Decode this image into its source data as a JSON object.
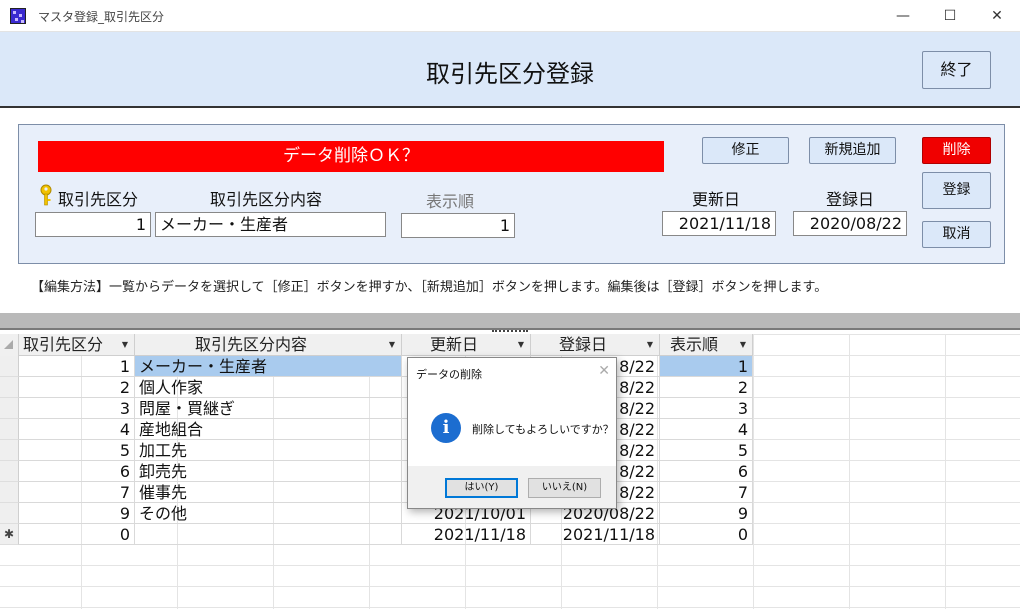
{
  "window": {
    "title": "マスタ登録_取引先区分",
    "minimize": "—",
    "maximize": "☐",
    "close": "✕"
  },
  "header": {
    "title": "取引先区分登録",
    "exit_label": "終了"
  },
  "edit": {
    "banner": "データ削除ＯＫ？",
    "buttons": {
      "modify": "修正",
      "add_new": "新規追加",
      "delete": "削除",
      "register": "登録",
      "cancel": "取消"
    },
    "labels": {
      "code": "取引先区分",
      "content": "取引先区分内容",
      "order": "表示順",
      "updated": "更新日",
      "registered": "登録日"
    },
    "values": {
      "code": "1",
      "content": "メーカー・生産者",
      "order": "1",
      "updated": "2021/11/18",
      "registered": "2020/08/22"
    }
  },
  "help_text": "【編集方法】一覧からデータを選択して［修正］ボタンを押すか、［新規追加］ボタンを押します。編集後は［登録］ボタンを押します。",
  "table": {
    "headers": [
      "取引先区分",
      "取引先区分内容",
      "更新日",
      "登録日",
      "表示順"
    ],
    "rows": [
      {
        "selector": "",
        "code": "1",
        "content": "メーカー・生産者",
        "updated": "",
        "registered": "8/22",
        "order": "1"
      },
      {
        "selector": "",
        "code": "2",
        "content": "個人作家",
        "updated": "",
        "registered": "8/22",
        "order": "2"
      },
      {
        "selector": "",
        "code": "3",
        "content": "問屋・買継ぎ",
        "updated": "",
        "registered": "8/22",
        "order": "3"
      },
      {
        "selector": "",
        "code": "4",
        "content": "産地組合",
        "updated": "",
        "registered": "8/22",
        "order": "4"
      },
      {
        "selector": "",
        "code": "5",
        "content": "加工先",
        "updated": "",
        "registered": "8/22",
        "order": "5"
      },
      {
        "selector": "",
        "code": "6",
        "content": "卸売先",
        "updated": "",
        "registered": "8/22",
        "order": "6"
      },
      {
        "selector": "",
        "code": "7",
        "content": "催事先",
        "updated": "",
        "registered": "8/22",
        "order": "7"
      },
      {
        "selector": "",
        "code": "9",
        "content": "その他",
        "updated": "2021/10/01",
        "registered": "2020/08/22",
        "order": "9"
      },
      {
        "selector": "✱",
        "code": "0",
        "content": "",
        "updated": "2021/11/18",
        "registered": "2021/11/18",
        "order": "0"
      }
    ]
  },
  "dialog": {
    "title": "データの削除",
    "close": "✕",
    "message": "削除してもよろしいですか？",
    "yes_label": "はい(Y)",
    "no_label": "いいえ(N)"
  }
}
